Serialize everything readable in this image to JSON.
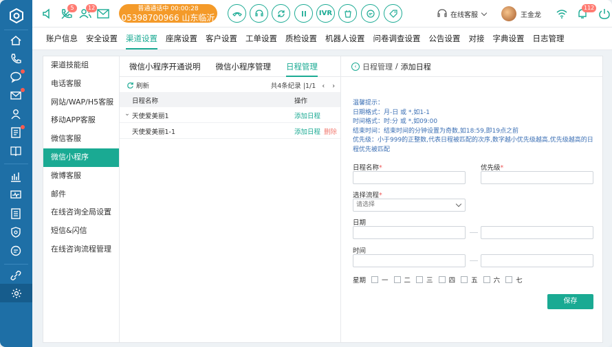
{
  "colors": {
    "primary": "#1aaa93",
    "rail": "#1e6fa6",
    "call": "#f49a29",
    "alert": "#ff5a4e",
    "tips": "#3b6fb4"
  },
  "topbar": {
    "badge_missed": "5",
    "badge_group": "12",
    "call_status": "普通通话中  00:00:28",
    "call_number": "05398700966 山东临沂",
    "ivr_label": "IVR",
    "agent_status": "在线客服",
    "user_name": "王金龙",
    "notif_count": "112"
  },
  "menu": [
    "账户信息",
    "安全设置",
    "渠道设置",
    "座席设置",
    "客户设置",
    "工单设置",
    "质检设置",
    "机器人设置",
    "问卷调查设置",
    "公告设置",
    "对接",
    "字典设置",
    "日志管理"
  ],
  "menu_active": 2,
  "submenu": [
    "渠道技能组",
    "电话客服",
    "网站/WAP/H5客服",
    "移动APP客服",
    "微信客服",
    "微信小程序",
    "微博客服",
    "邮件",
    "在线咨询全局设置",
    "短信&闪信",
    "在线咨询流程管理"
  ],
  "submenu_active": 5,
  "tabs": [
    "微信小程序开通说明",
    "微信小程序管理",
    "日程管理"
  ],
  "tabs_active": 2,
  "list": {
    "refresh": "刷新",
    "paging": "共4条纪录 |1/1",
    "col_name": "日程名称",
    "col_action": "操作",
    "rows": [
      {
        "name": "天使爱美丽1",
        "add": "添加日程",
        "del": ""
      },
      {
        "name": "天使爱美丽1-1",
        "add": "添加日程",
        "del": "删除"
      }
    ]
  },
  "form": {
    "breadcrumb_parent": "日程管理",
    "breadcrumb_sep": "/",
    "breadcrumb_current": "添加日程",
    "tips": [
      "温馨提示：",
      "日期格式：月-日 或 *,如1-1",
      "时间格式：时:分 或 *,如09:00",
      "结束时间：结束时间的分钟设置为奇数,如18:59,即19点之前",
      "优先级：小于999的正整数,代表日程被匹配的次序,数字越小优先级越高,优先级越高的日程优先被匹配"
    ],
    "name_label": "日程名称",
    "priority_label": "优先级",
    "flow_label": "选择流程",
    "flow_placeholder": "请选择",
    "date_label": "日期",
    "time_label": "时间",
    "week_label": "星期",
    "days": [
      "一",
      "二",
      "三",
      "四",
      "五",
      "六",
      "七"
    ],
    "required_mark": "*",
    "save": "保存"
  },
  "icons": {
    "rail": [
      "home-icon",
      "phone-icon",
      "chat-icon",
      "mail-icon",
      "contacts-icon",
      "form-icon",
      "book-icon",
      "chart-icon",
      "monitor-icon",
      "report-icon",
      "shield-icon",
      "message-icon",
      "link-icon",
      "gear-icon"
    ]
  }
}
